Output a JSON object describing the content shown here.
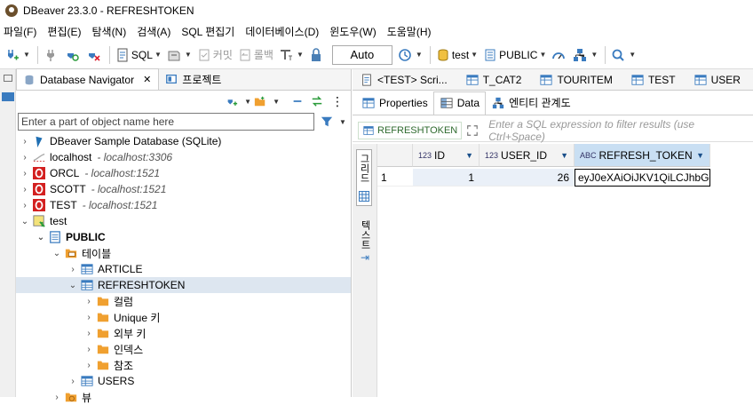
{
  "window": {
    "title": "DBeaver 23.3.0 - REFRESHTOKEN"
  },
  "menu": [
    "파일(F)",
    "편집(E)",
    "탐색(N)",
    "검색(A)",
    "SQL 편집기",
    "데이터베이스(D)",
    "윈도우(W)",
    "도움말(H)"
  ],
  "toolbar": {
    "sql": "SQL",
    "commit": "커밋",
    "rollback": "롤백",
    "tx_mode": "Auto",
    "datasource": "test",
    "schema": "PUBLIC"
  },
  "nav": {
    "tabs": [
      "Database Navigator",
      "프로젝트"
    ],
    "filter_placeholder": "Enter a part of object name here",
    "tree": [
      {
        "label": "DBeaver Sample Database (SQLite)",
        "host": "",
        "icon": "sqlite-icon"
      },
      {
        "label": "localhost",
        "host": "- localhost:3306",
        "icon": "mysql-icon"
      },
      {
        "label": "ORCL",
        "host": "- localhost:1521",
        "icon": "oracle-icon"
      },
      {
        "label": "SCOTT",
        "host": "- localhost:1521",
        "icon": "oracle-icon"
      },
      {
        "label": "TEST",
        "host": "- localhost:1521",
        "icon": "oracle-icon"
      },
      {
        "label": "test",
        "host": "",
        "icon": "h2-icon"
      },
      {
        "label": "PUBLIC",
        "host": "",
        "icon": "schema-icon"
      },
      {
        "label": "테이블",
        "host": "",
        "icon": "tables-folder-icon"
      },
      {
        "label": "ARTICLE",
        "host": "",
        "icon": "table-icon"
      },
      {
        "label": "REFRESHTOKEN",
        "host": "",
        "icon": "table-icon"
      },
      {
        "label": "컬럼",
        "host": "",
        "icon": "folder-icon"
      },
      {
        "label": "Unique 키",
        "host": "",
        "icon": "folder-icon"
      },
      {
        "label": "외부 키",
        "host": "",
        "icon": "folder-icon"
      },
      {
        "label": "인덱스",
        "host": "",
        "icon": "folder-icon"
      },
      {
        "label": "참조",
        "host": "",
        "icon": "folder-icon"
      },
      {
        "label": "USERS",
        "host": "",
        "icon": "table-icon"
      },
      {
        "label": "뷰",
        "host": "",
        "icon": "views-icon"
      }
    ]
  },
  "editor": {
    "tabs": [
      "<TEST> Scri...",
      "T_CAT2",
      "TOURITEM",
      "TEST",
      "USER"
    ],
    "subtabs": [
      "Properties",
      "Data",
      "엔티티 관계도"
    ],
    "table_name": "REFRESHTOKEN",
    "filter_placeholder": "Enter a SQL expression to filter results (use Ctrl+Space)",
    "side_tabs": [
      "그리드",
      "텍스트"
    ],
    "columns": [
      {
        "type": "123",
        "name": "ID"
      },
      {
        "type": "123",
        "name": "USER_ID"
      },
      {
        "type": "ABC",
        "name": "REFRESH_TOKEN"
      }
    ],
    "rows": [
      {
        "num": "1",
        "cells": [
          "1",
          "26",
          "eyJ0eXAiOiJKV1QiLCJhbGciO"
        ]
      }
    ]
  }
}
